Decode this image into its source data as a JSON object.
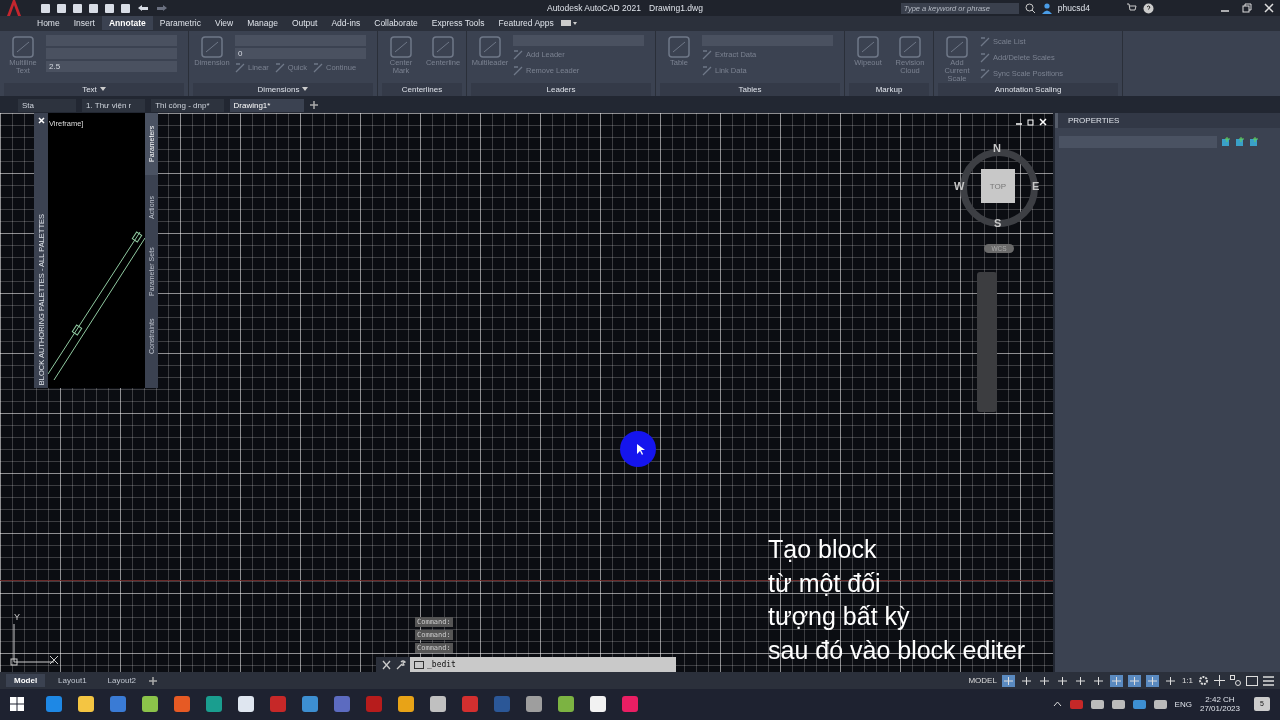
{
  "title_bar": {
    "app_title": "Autodesk AutoCAD 2021",
    "file_name": "Drawing1.dwg",
    "search": {
      "placeholder": "Type a keyword or phrase"
    },
    "user": "phucsd4"
  },
  "menu_tabs": [
    {
      "label": "Home",
      "selected": false
    },
    {
      "label": "Insert",
      "selected": false
    },
    {
      "label": "Annotate",
      "selected": true
    },
    {
      "label": "Parametric",
      "selected": false
    },
    {
      "label": "View",
      "selected": false
    },
    {
      "label": "Manage",
      "selected": false
    },
    {
      "label": "Output",
      "selected": false
    },
    {
      "label": "Add-ins",
      "selected": false
    },
    {
      "label": "Collaborate",
      "selected": false
    },
    {
      "label": "Express Tools",
      "selected": false
    },
    {
      "label": "Featured Apps",
      "selected": false
    }
  ],
  "ribbon_panels": [
    {
      "title": "Text",
      "menu": true,
      "controls": [
        {
          "kind": "large",
          "label": "Multiline Text"
        },
        {
          "kind": "field"
        },
        {
          "kind": "field"
        },
        {
          "kind": "field",
          "value": "2.5"
        }
      ]
    },
    {
      "title": "Dimensions",
      "menu": true,
      "controls": [
        {
          "kind": "large",
          "label": "Dimension"
        },
        {
          "kind": "field"
        },
        {
          "kind": "field",
          "value": "0"
        },
        {
          "kind": "inline",
          "label": "Linear"
        },
        {
          "kind": "inline",
          "label": "Quick"
        },
        {
          "kind": "inline",
          "label": "Continue"
        }
      ]
    },
    {
      "title": "Centerlines",
      "menu": false,
      "controls": [
        {
          "kind": "large",
          "label": "Center Mark"
        },
        {
          "kind": "large",
          "label": "Centerline"
        }
      ]
    },
    {
      "title": "Leaders",
      "menu": false,
      "controls": [
        {
          "kind": "large",
          "label": "Multileader"
        },
        {
          "kind": "field"
        },
        {
          "kind": "small",
          "label": "Add Leader"
        },
        {
          "kind": "small",
          "label": "Remove Leader"
        }
      ]
    },
    {
      "title": "Tables",
      "menu": false,
      "controls": [
        {
          "kind": "large",
          "label": "Table"
        },
        {
          "kind": "field"
        },
        {
          "kind": "small",
          "label": "Extract Data"
        },
        {
          "kind": "small",
          "label": "Link Data"
        }
      ]
    },
    {
      "title": "Markup",
      "menu": false,
      "controls": [
        {
          "kind": "large",
          "label": "Wipeout"
        },
        {
          "kind": "large",
          "label": "Revision Cloud"
        }
      ]
    },
    {
      "title": "Annotation Scaling",
      "menu": false,
      "controls": [
        {
          "kind": "large",
          "label": "Add Current Scale"
        },
        {
          "kind": "small",
          "label": "Scale List"
        },
        {
          "kind": "small",
          "label": "Add/Delete Scales"
        },
        {
          "kind": "small",
          "label": "Sync Scale Positions"
        }
      ]
    }
  ],
  "document_tabs": [
    {
      "label": "Sta",
      "selected": false
    },
    {
      "label": "1. Thư viện r",
      "selected": false
    },
    {
      "label": "Thi công - dnp*",
      "selected": false
    },
    {
      "label": "Drawing1*",
      "selected": true
    }
  ],
  "palette": {
    "title": "BLOCK AUTHORING PALETTES - ALL PALETTES",
    "viewport_label": "Vireframe]",
    "tabs": [
      {
        "label": "Parameters",
        "selected": true
      },
      {
        "label": "Actions",
        "selected": false
      },
      {
        "label": "Parameter Sets",
        "selected": false
      },
      {
        "label": "Constraints",
        "selected": false
      }
    ]
  },
  "viewcube": {
    "north": "N",
    "south": "S",
    "east": "E",
    "west": "W",
    "face": "TOP",
    "ucs": "WCS"
  },
  "ucs_icon": {
    "y": "Y"
  },
  "command_history": [
    "Command:",
    "Command:",
    "Command:"
  ],
  "command_line": {
    "value": "_bedit"
  },
  "caption_lines": [
    "Tạo block",
    "từ một đối",
    "tượng bất kỳ",
    "sau đó vào block editer"
  ],
  "properties": {
    "title": "PROPERTIES"
  },
  "layout_tabs": [
    {
      "label": "Model",
      "selected": true
    },
    {
      "label": "Layout1",
      "selected": false
    },
    {
      "label": "Layout2",
      "selected": false
    }
  ],
  "status_bar": {
    "space": "MODEL",
    "scale": "1:1"
  },
  "taskbar": {
    "language": "ENG",
    "time": "2:42 CH",
    "date": "27/01/2023",
    "notifications": "5"
  }
}
